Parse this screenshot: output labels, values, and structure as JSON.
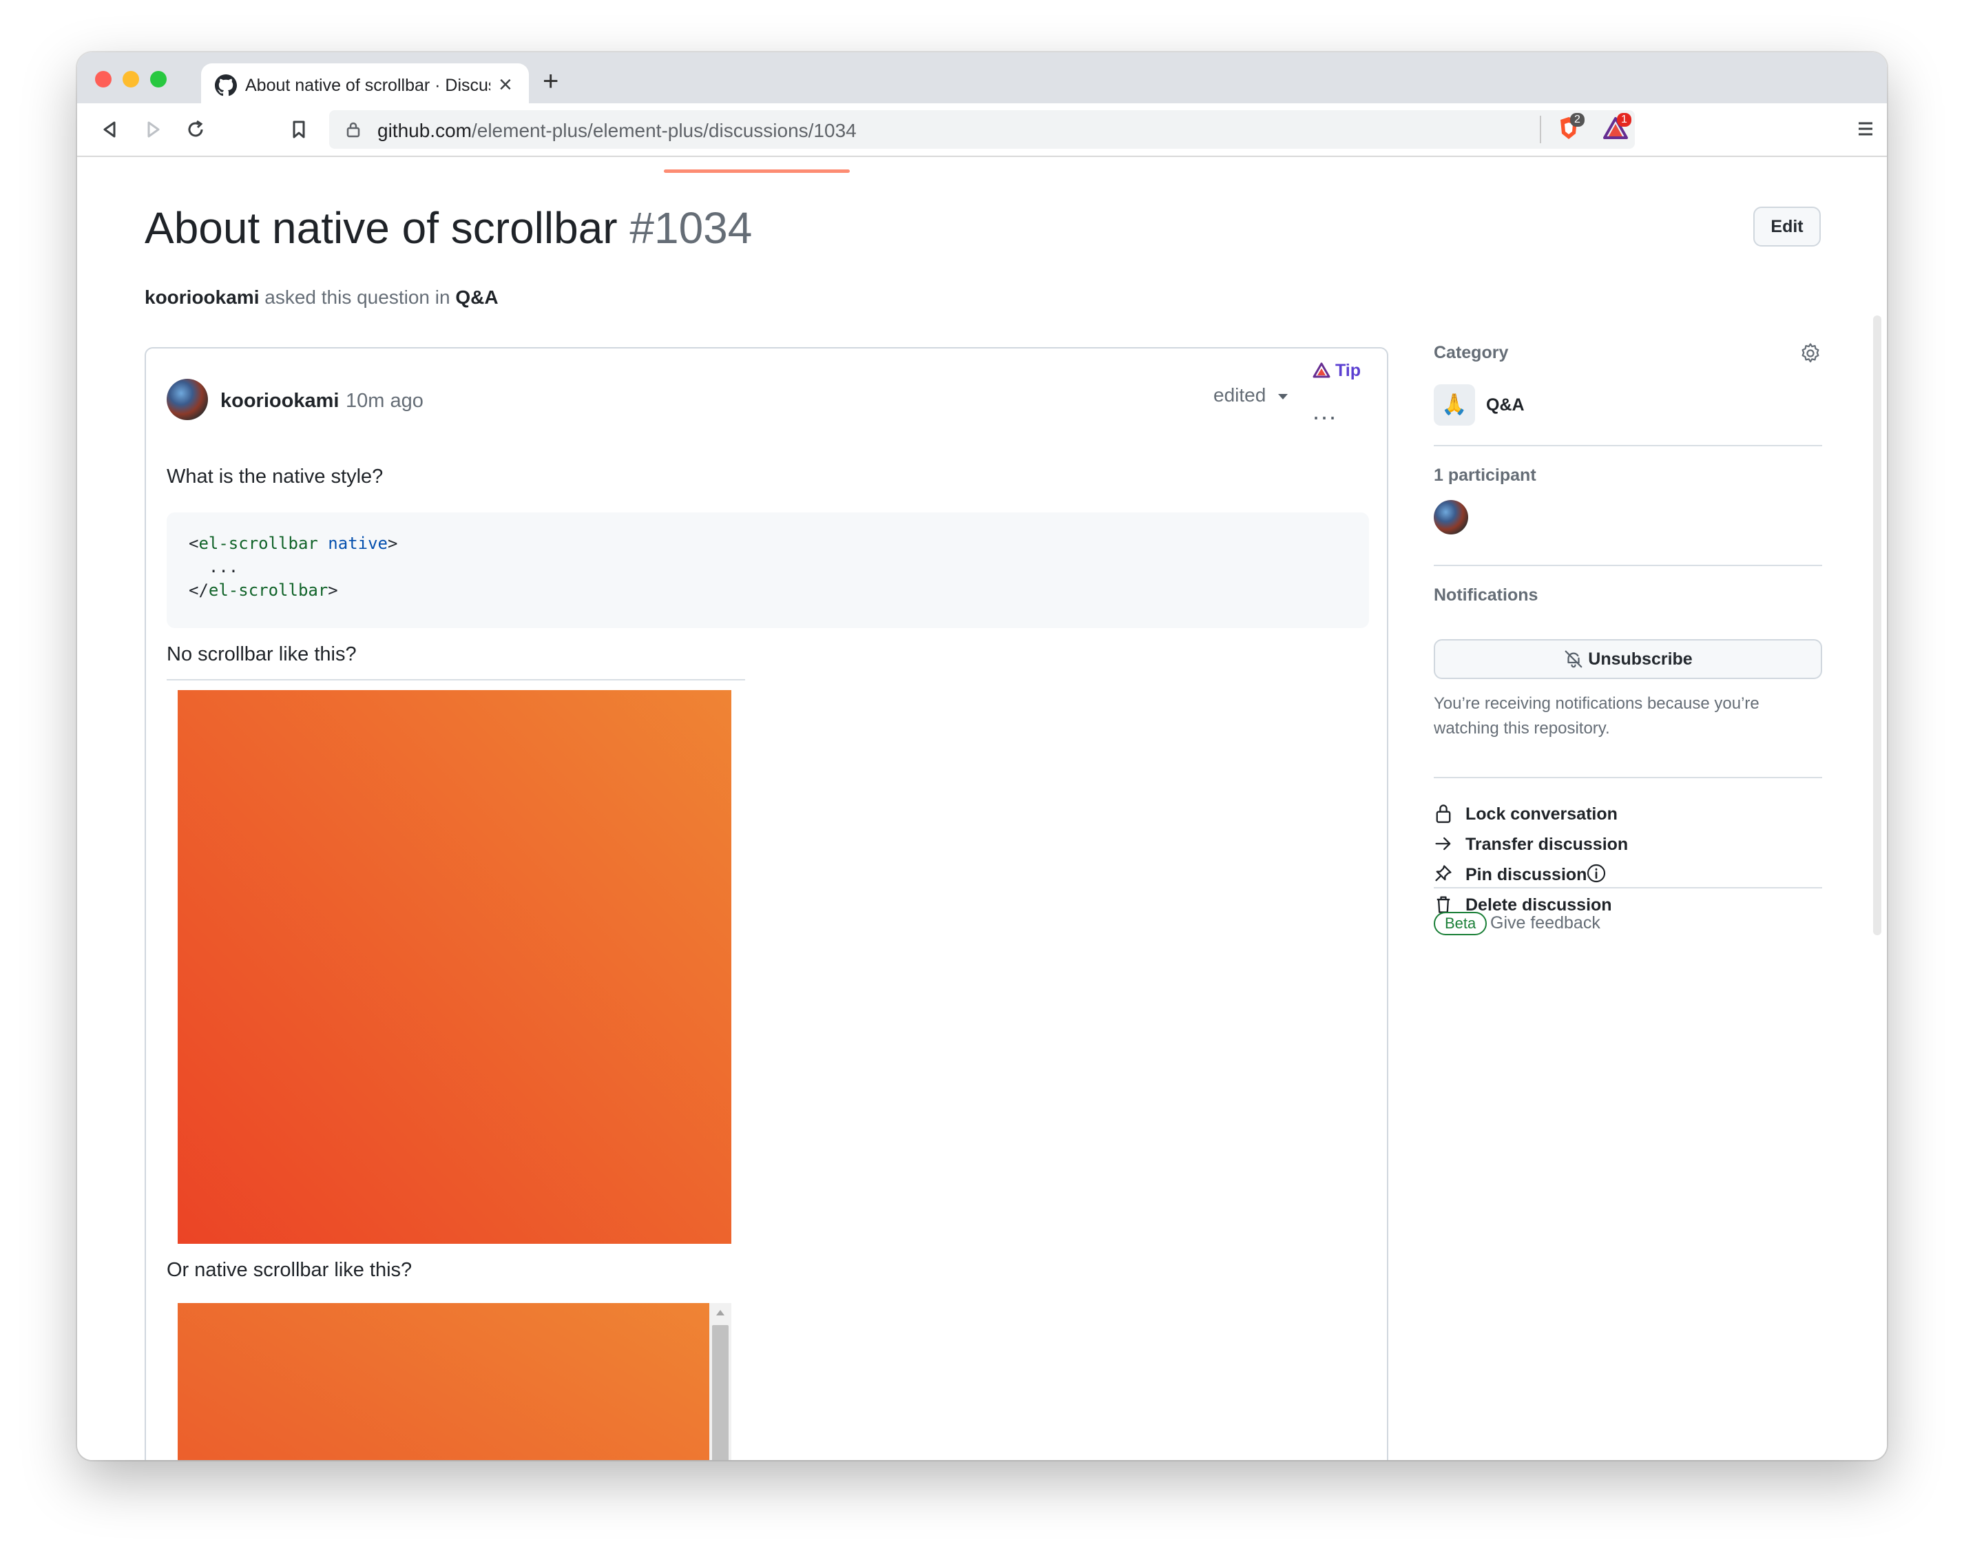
{
  "browser": {
    "tab_title": "About native of scrollbar · Discussion",
    "tab_close": "×",
    "new_tab": "+",
    "url_host": "github.com",
    "url_path": "/element-plus/element-plus/discussions/1034",
    "brave_badge": "2",
    "rewards_badge": "1"
  },
  "discussion": {
    "title": "About native of scrollbar",
    "number": "#1034",
    "edit_label": "Edit",
    "asker": "kooriookami",
    "asked_text": " asked this question in ",
    "category": "Q&A"
  },
  "post": {
    "author": "kooriookami",
    "time_ago": "10m ago",
    "edited_label": "edited",
    "tip_label": "Tip",
    "menu": "...",
    "question": "What is the native style?",
    "code_lines": [
      {
        "open": "<",
        "tag": "el-scrollbar",
        "attr": " native",
        "close": ">"
      },
      {
        "text": "  ..."
      },
      {
        "open": "</",
        "tag": "el-scrollbar",
        "close": ">"
      }
    ],
    "para_no_scrollbar": "No scrollbar like this?",
    "para_native_scrollbar": "Or native scrollbar like this?"
  },
  "sidebar": {
    "category_heading": "Category",
    "category_emoji": "🙏",
    "category_name": "Q&A",
    "participants_heading": "1 participant",
    "notifications_heading": "Notifications",
    "unsubscribe_label": "Unsubscribe",
    "notification_note": "You’re receiving notifications because you’re watching this repository.",
    "actions": [
      {
        "label": "Lock conversation",
        "icon": "lock-icon"
      },
      {
        "label": "Transfer discussion",
        "icon": "arrow-right-icon"
      },
      {
        "label": "Pin discussion",
        "icon": "pin-icon"
      },
      {
        "label": "Delete discussion",
        "icon": "trash-icon"
      }
    ],
    "beta_label": "Beta",
    "feedback_label": "Give feedback"
  },
  "colors": {
    "tab_underline": "#fd8c73",
    "beta_green": "#1a7f37",
    "gradient_start": "#eb4426",
    "gradient_end": "#ef8434"
  }
}
